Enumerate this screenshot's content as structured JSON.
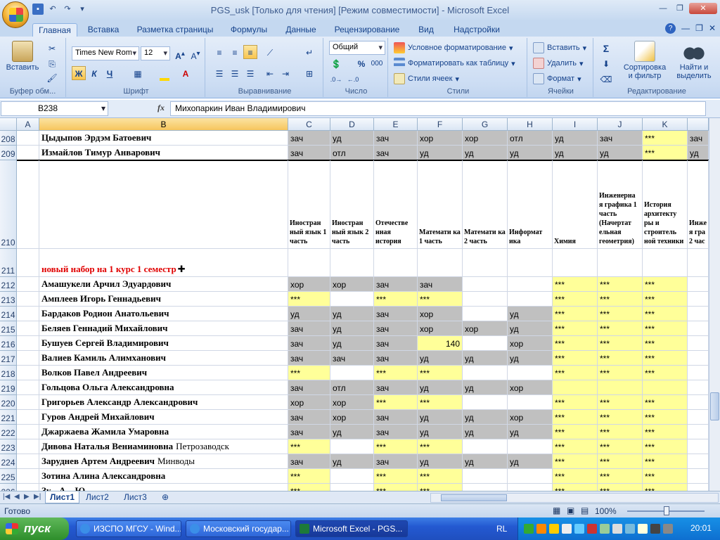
{
  "window": {
    "title": "PGS_usk  [Только для чтения]  [Режим совместимости] - Microsoft Excel"
  },
  "ribbon_tabs": [
    "Главная",
    "Вставка",
    "Разметка страницы",
    "Формулы",
    "Данные",
    "Рецензирование",
    "Вид",
    "Надстройки"
  ],
  "ribbon": {
    "clipboard": {
      "paste": "Вставить",
      "label": "Буфер обм..."
    },
    "font": {
      "name": "Times New Rom",
      "size": "12",
      "bold": "Ж",
      "italic": "К",
      "underline": "Ч",
      "label": "Шрифт"
    },
    "alignment": {
      "label": "Выравнивание"
    },
    "number": {
      "format": "Общий",
      "percent": "%",
      "thousands": "000",
      "label": "Число"
    },
    "styles": {
      "conditional": "Условное форматирование",
      "as_table": "Форматировать как таблицу",
      "cell_styles": "Стили ячеек",
      "label": "Стили"
    },
    "cells": {
      "insert": "Вставить",
      "delete": "Удалить",
      "format": "Формат",
      "label": "Ячейки"
    },
    "editing": {
      "sort": "Сортировка",
      "sort2": "и фильтр",
      "find": "Найти и",
      "find2": "выделить",
      "label": "Редактирование",
      "sigma": "Σ"
    }
  },
  "formula_bar": {
    "name_box": "B238",
    "fx": "fx",
    "content": "Михопаркин Иван Владимирович"
  },
  "columns": [
    "A",
    "B",
    "C",
    "D",
    "E",
    "F",
    "G",
    "H",
    "I",
    "J",
    "K",
    ""
  ],
  "rows": [
    {
      "n": "208",
      "name": "Цыдыпов Эрдэм Батоевич",
      "cells": [
        [
          "зач",
          "g"
        ],
        [
          "уд",
          "g"
        ],
        [
          "зач",
          "g"
        ],
        [
          "хор",
          "g"
        ],
        [
          "хор",
          "g"
        ],
        [
          "отл",
          "g"
        ],
        [
          "уд",
          "g"
        ],
        [
          "зач",
          "g"
        ],
        [
          "***",
          "y"
        ],
        [
          "зач",
          "g"
        ]
      ]
    },
    {
      "n": "209",
      "name": "Измайлов Тимур Анварович",
      "cells": [
        [
          "зач",
          "g"
        ],
        [
          "отл",
          "g"
        ],
        [
          "зач",
          "g"
        ],
        [
          "уд",
          "g"
        ],
        [
          "уд",
          "g"
        ],
        [
          "уд",
          "g"
        ],
        [
          "уд",
          "g"
        ],
        [
          "уд",
          "g"
        ],
        [
          "***",
          "y"
        ],
        [
          "уд",
          "g"
        ]
      ]
    }
  ],
  "header_row": {
    "n": "210",
    "cols": [
      "Иностран ный язык 1 часть",
      "Иностран ный язык 2 часть",
      "Отечестве нная история",
      "Математи ка 1 часть",
      "Математи ка 2 часть",
      "Информат ика",
      "Химия",
      "Инженерна я графика 1 часть (Начертат ельная геометрия)",
      "История архитекту ры и строитель ной техники",
      "Инже я гра 2 час"
    ]
  },
  "row211": {
    "n": "211",
    "text": "новый набор на 1 курс 1 семестр"
  },
  "students": [
    {
      "n": "212",
      "name": "Амашукели Арчил Эдуардович",
      "extra": "",
      "cells": [
        [
          "хор",
          "g"
        ],
        [
          "хор",
          "g"
        ],
        [
          "зач",
          "g"
        ],
        [
          "зач",
          "g"
        ],
        [
          "",
          ""
        ],
        [
          "",
          ""
        ],
        [
          "***",
          "y"
        ],
        [
          "***",
          "y"
        ],
        [
          "***",
          "y"
        ],
        [
          "",
          ""
        ]
      ]
    },
    {
      "n": "213",
      "name": "Амплеев Игорь Геннадьевич",
      "extra": "",
      "cells": [
        [
          "***",
          "y"
        ],
        [
          "",
          ""
        ],
        [
          "***",
          "y"
        ],
        [
          "***",
          "y"
        ],
        [
          "",
          ""
        ],
        [
          "",
          ""
        ],
        [
          "***",
          "y"
        ],
        [
          "***",
          "y"
        ],
        [
          "***",
          "y"
        ],
        [
          "",
          ""
        ]
      ]
    },
    {
      "n": "214",
      "name": "Бардаков Родион Анатольевич",
      "extra": "",
      "cells": [
        [
          "уд",
          "g"
        ],
        [
          "уд",
          "g"
        ],
        [
          "зач",
          "g"
        ],
        [
          "хор",
          "g"
        ],
        [
          "",
          ""
        ],
        [
          "уд",
          "g"
        ],
        [
          "***",
          "y"
        ],
        [
          "***",
          "y"
        ],
        [
          "***",
          "y"
        ],
        [
          "",
          ""
        ]
      ]
    },
    {
      "n": "215",
      "name": "Беляев Геннадий Михайлович",
      "extra": "",
      "cells": [
        [
          "зач",
          "g"
        ],
        [
          "уд",
          "g"
        ],
        [
          "зач",
          "g"
        ],
        [
          "хор",
          "g"
        ],
        [
          "хор",
          "g"
        ],
        [
          "уд",
          "g"
        ],
        [
          "***",
          "y"
        ],
        [
          "***",
          "y"
        ],
        [
          "***",
          "y"
        ],
        [
          "",
          ""
        ]
      ]
    },
    {
      "n": "216",
      "name": "Бушуев Сергей Владимирович",
      "extra": "",
      "cells": [
        [
          "зач",
          "g"
        ],
        [
          "уд",
          "g"
        ],
        [
          "зач",
          "g"
        ],
        [
          "140",
          "yn"
        ],
        [
          "",
          ""
        ],
        [
          "хор",
          "g"
        ],
        [
          "***",
          "y"
        ],
        [
          "***",
          "y"
        ],
        [
          "***",
          "y"
        ],
        [
          "",
          ""
        ]
      ]
    },
    {
      "n": "217",
      "name": "Валиев Камиль Алимханович",
      "extra": "",
      "cells": [
        [
          "зач",
          "g"
        ],
        [
          "зач",
          "g"
        ],
        [
          "зач",
          "g"
        ],
        [
          "уд",
          "g"
        ],
        [
          "уд",
          "g"
        ],
        [
          "уд",
          "g"
        ],
        [
          "***",
          "y"
        ],
        [
          "***",
          "y"
        ],
        [
          "***",
          "y"
        ],
        [
          "",
          ""
        ]
      ]
    },
    {
      "n": "218",
      "name": "Волков Павел Андреевич",
      "extra": "",
      "cells": [
        [
          "***",
          "y"
        ],
        [
          "",
          ""
        ],
        [
          "***",
          "y"
        ],
        [
          "***",
          "y"
        ],
        [
          "",
          ""
        ],
        [
          "",
          ""
        ],
        [
          "***",
          "y"
        ],
        [
          "***",
          "y"
        ],
        [
          "***",
          "y"
        ],
        [
          "",
          ""
        ]
      ]
    },
    {
      "n": "219",
      "name": "Гольцова Ольга Александровна",
      "extra": "",
      "cells": [
        [
          "зач",
          "g"
        ],
        [
          "отл",
          "g"
        ],
        [
          "зач",
          "g"
        ],
        [
          "уд",
          "g"
        ],
        [
          "уд",
          "g"
        ],
        [
          "хор",
          "g"
        ],
        [
          "",
          "y"
        ],
        [
          "",
          "y"
        ],
        [
          "",
          "y"
        ],
        [
          "",
          ""
        ]
      ]
    },
    {
      "n": "220",
      "name": "Григорьев Александр Александрович",
      "extra": "",
      "cells": [
        [
          "хор",
          "g"
        ],
        [
          "хор",
          "g"
        ],
        [
          "***",
          "y"
        ],
        [
          "***",
          "y"
        ],
        [
          "",
          ""
        ],
        [
          "",
          ""
        ],
        [
          "***",
          "y"
        ],
        [
          "***",
          "y"
        ],
        [
          "***",
          "y"
        ],
        [
          "",
          ""
        ]
      ]
    },
    {
      "n": "221",
      "name": "Гуров Андрей Михайлович",
      "extra": "",
      "cells": [
        [
          "зач",
          "g"
        ],
        [
          "хор",
          "g"
        ],
        [
          "зач",
          "g"
        ],
        [
          "уд",
          "g"
        ],
        [
          "уд",
          "g"
        ],
        [
          "хор",
          "g"
        ],
        [
          "***",
          "y"
        ],
        [
          "***",
          "y"
        ],
        [
          "***",
          "y"
        ],
        [
          "",
          ""
        ]
      ]
    },
    {
      "n": "222",
      "name": "Джаржаева Жамила Умаровна",
      "extra": "",
      "cells": [
        [
          "зач",
          "g"
        ],
        [
          "уд",
          "g"
        ],
        [
          "зач",
          "g"
        ],
        [
          "уд",
          "g"
        ],
        [
          "уд",
          "g"
        ],
        [
          "уд",
          "g"
        ],
        [
          "***",
          "y"
        ],
        [
          "***",
          "y"
        ],
        [
          "***",
          "y"
        ],
        [
          "",
          ""
        ]
      ]
    },
    {
      "n": "223",
      "name": "Дивова Наталья Вениаминовна",
      "extra": "Петрозаводск",
      "cells": [
        [
          "***",
          "y"
        ],
        [
          "",
          ""
        ],
        [
          "***",
          "y"
        ],
        [
          "***",
          "y"
        ],
        [
          "",
          ""
        ],
        [
          "",
          ""
        ],
        [
          "***",
          "y"
        ],
        [
          "***",
          "y"
        ],
        [
          "***",
          "y"
        ],
        [
          "",
          ""
        ]
      ]
    },
    {
      "n": "224",
      "name": "Заруднев Артем Андреевич",
      "extra": "Минводы",
      "cells": [
        [
          "зач",
          "g"
        ],
        [
          "уд",
          "g"
        ],
        [
          "зач",
          "g"
        ],
        [
          "уд",
          "g"
        ],
        [
          "уд",
          "g"
        ],
        [
          "уд",
          "g"
        ],
        [
          "***",
          "y"
        ],
        [
          "***",
          "y"
        ],
        [
          "***",
          "y"
        ],
        [
          "",
          ""
        ]
      ]
    },
    {
      "n": "225",
      "name": "Зотина Алина Александровна",
      "extra": "",
      "cells": [
        [
          "***",
          "y"
        ],
        [
          "",
          ""
        ],
        [
          "***",
          "y"
        ],
        [
          "***",
          "y"
        ],
        [
          "",
          ""
        ],
        [
          "",
          ""
        ],
        [
          "***",
          "y"
        ],
        [
          "***",
          "y"
        ],
        [
          "***",
          "y"
        ],
        [
          "",
          ""
        ]
      ]
    },
    {
      "n": "226",
      "name": "Зу...  А...  Ю...",
      "extra": "",
      "cells": [
        [
          "***",
          "y"
        ],
        [
          "",
          ""
        ],
        [
          "***",
          "y"
        ],
        [
          "***",
          "y"
        ],
        [
          "",
          ""
        ],
        [
          "",
          ""
        ],
        [
          "***",
          "y"
        ],
        [
          "***",
          "y"
        ],
        [
          "***",
          "y"
        ],
        [
          "",
          ""
        ]
      ]
    }
  ],
  "sheets": [
    "Лист1",
    "Лист2",
    "Лист3"
  ],
  "status": {
    "ready": "Готово",
    "zoom": "100%"
  },
  "taskbar": {
    "start": "пуск",
    "tasks": [
      "ИЗСПО МГСУ - Wind...",
      "Московский государ...",
      "Microsoft Excel - PGS..."
    ],
    "lang": "RL",
    "clock": "20:01"
  }
}
